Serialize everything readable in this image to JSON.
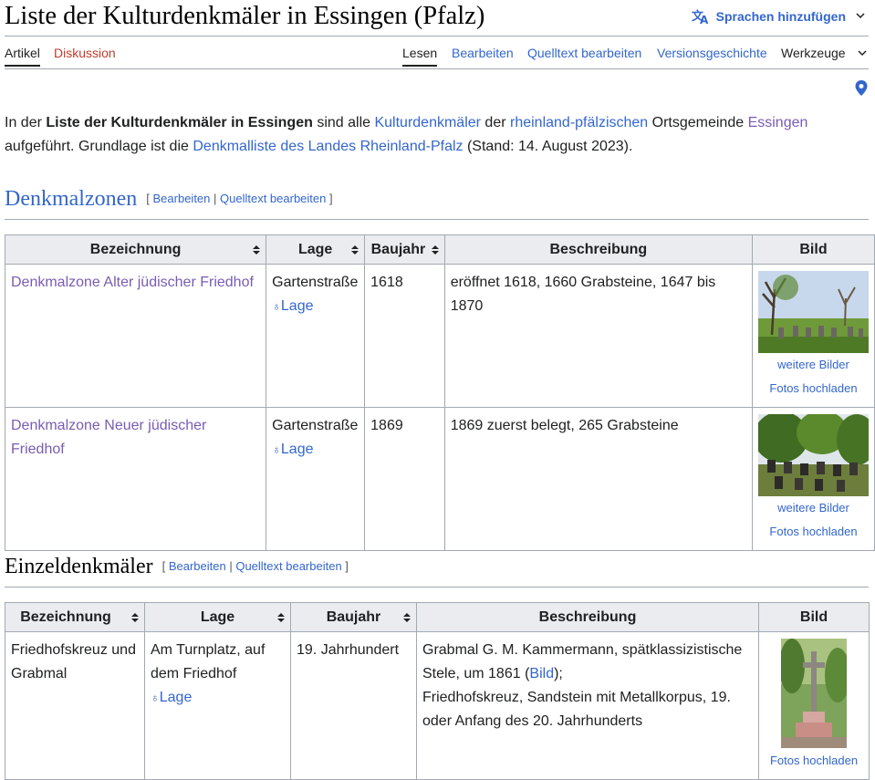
{
  "page": {
    "title": "Liste der Kulturdenkmäler in Essingen (Pfalz)",
    "add_languages": "Sprachen hinzufügen"
  },
  "tabs": {
    "artikel": "Artikel",
    "diskussion": "Diskussion",
    "lesen": "Lesen",
    "bearbeiten": "Bearbeiten",
    "quelltext": "Quelltext bearbeiten",
    "versionen": "Versionsgeschichte",
    "werkzeuge": "Werkzeuge"
  },
  "intro": {
    "p1": "In der ",
    "bold": "Liste der Kulturdenkmäler in Essingen",
    "p2": " sind alle ",
    "link1": "Kulturdenkmäler",
    "p3": " der ",
    "link2": "rheinland-pfälzischen",
    "p4": " Ortsgemeinde ",
    "link3": "Essingen",
    "p5": " aufgeführt. Grundlage ist die ",
    "link4": "Denkmalliste des Landes Rheinland-Pfalz",
    "p6": " (Stand: 14. August 2023)."
  },
  "edit": {
    "open": "[ ",
    "bearbeiten": "Bearbeiten",
    "sep": " | ",
    "quelltext": "Quelltext bearbeiten",
    "close": " ]"
  },
  "section1": {
    "heading": "Denkmalzonen",
    "headers": [
      "Bezeichnung",
      "Lage",
      "Baujahr",
      "Beschreibung",
      "Bild"
    ],
    "rows": [
      {
        "name": "Denkmalzone Alter jüdischer Friedhof",
        "street": "Gartenstraße",
        "lage": "Lage",
        "year": "1618",
        "desc": "eröffnet 1618, 1660 Grabsteine, 1647 bis 1870",
        "more": "weitere Bilder",
        "upload": "Fotos hochladen"
      },
      {
        "name": "Denkmalzone Neuer jüdischer Friedhof",
        "street": "Gartenstraße",
        "lage": "Lage",
        "year": "1869",
        "desc": "1869 zuerst belegt, 265 Grabsteine",
        "more": "weitere Bilder",
        "upload": "Fotos hochladen"
      }
    ]
  },
  "section2": {
    "heading": "Einzeldenkmäler",
    "headers": [
      "Bezeichnung",
      "Lage",
      "Baujahr",
      "Beschreibung",
      "Bild"
    ],
    "rows": [
      {
        "name": "Friedhofskreuz und Grabmal",
        "street": "Am Turnplatz, auf dem Friedhof",
        "lage": "Lage",
        "year": "19. Jahrhundert",
        "desc1": "Grabmal G. M. Kammermann, spätklassizistische Stele, um 1861 (",
        "desc_link": "Bild",
        "desc2": ");",
        "desc3": "Friedhofskreuz, Sandstein mit Metallkorpus, 19. oder Anfang des 20. Jahrhunderts",
        "upload": "Fotos hochladen"
      }
    ]
  }
}
